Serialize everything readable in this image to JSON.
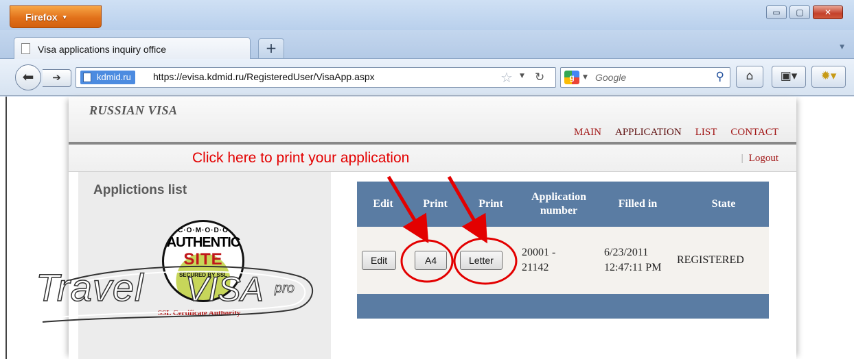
{
  "window": {
    "app_menu_label": "Firefox",
    "controls": {
      "minimize": "▭",
      "maximize": "▢",
      "close": "✕"
    }
  },
  "tabs": [
    {
      "title": "Visa applications inquiry office"
    }
  ],
  "new_tab_label": "+",
  "navbar": {
    "site_identity": "kdmid.ru",
    "url": "https://evisa.kdmid.ru/RegisteredUser/VisaApp.aspx",
    "search_placeholder": "Google"
  },
  "site": {
    "brand": "RUSSIAN VISA",
    "nav": [
      "MAIN",
      "APPLICATION",
      "LIST",
      "CONTACT"
    ],
    "active_nav": "APPLICATION",
    "logout": "Logout",
    "callout": "Click here to print your application",
    "sidebar_title": "Applictions list",
    "seal": {
      "top": "C·O·M·O·D·O",
      "authentic": "AUTHENTIC",
      "site": "SITE",
      "secured": "SECURED BY SSL"
    },
    "ssl_caption": "SSL Certificate Authority"
  },
  "table": {
    "headers": [
      "Edit",
      "Print",
      "Print",
      "Application number",
      "Filled in",
      "State"
    ],
    "rows": [
      {
        "edit_label": "Edit",
        "print_a4_label": "A4",
        "print_letter_label": "Letter",
        "application_number": "20001 - 21142",
        "filled_in": "6/23/2011 12:47:11 PM",
        "state": "REGISTERED"
      }
    ]
  },
  "watermark": {
    "travel": "Travel",
    "visa": "VISA",
    "pro": "pro"
  },
  "colors": {
    "annotation": "#e30000",
    "table_header": "#5a7ca3",
    "nav_link": "#a11515"
  }
}
